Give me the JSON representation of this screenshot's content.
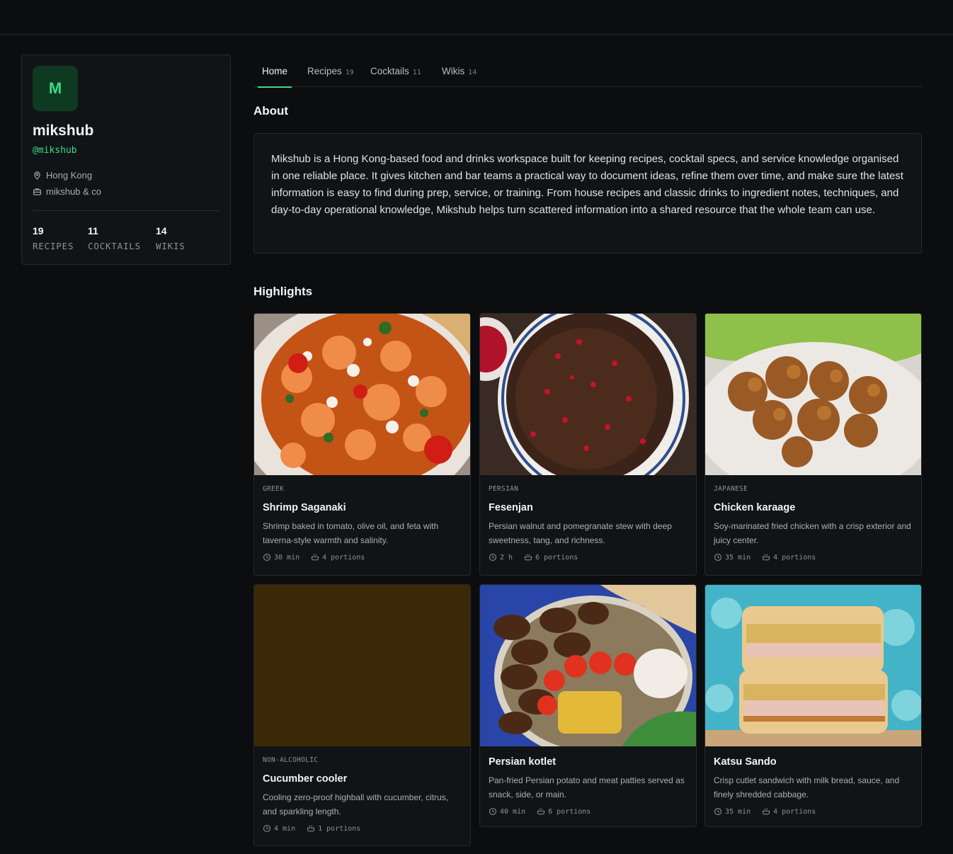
{
  "profile": {
    "avatar_letter": "M",
    "name": "mikshub",
    "handle": "@mikshub",
    "location": "Hong Kong",
    "company": "mikshub & co",
    "stats": [
      {
        "value": "19",
        "label": "RECIPES"
      },
      {
        "value": "11",
        "label": "COCKTAILS"
      },
      {
        "value": "14",
        "label": "WIKIS"
      }
    ]
  },
  "tabs": [
    {
      "label": "Home",
      "count": ""
    },
    {
      "label": "Recipes",
      "count": "19"
    },
    {
      "label": "Cocktails",
      "count": "11"
    },
    {
      "label": "Wikis",
      "count": "14"
    }
  ],
  "about": {
    "title": "About",
    "text": "Mikshub is a Hong Kong-based food and drinks workspace built for keeping recipes, cocktail specs, and service knowledge organised in one reliable place. It gives kitchen and bar teams a practical way to document ideas, refine them over time, and make sure the latest information is easy to find during prep, service, or training. From house recipes and classic drinks to ingredient notes, techniques, and day-to-day operational knowledge, Mikshub helps turn scattered information into a shared resource that the whole team can use."
  },
  "highlights": {
    "title": "Highlights",
    "cards": [
      {
        "cuisine": "GREEK",
        "title": "Shrimp Saganaki",
        "desc": "Shrimp baked in tomato, olive oil, and feta with taverna-style warmth and salinity.",
        "time": "30 min",
        "portions": "4 portions"
      },
      {
        "cuisine": "PERSIAN",
        "title": "Fesenjan",
        "desc": "Persian walnut and pomegranate stew with deep sweetness, tang, and richness.",
        "time": "2 h",
        "portions": "6 portions"
      },
      {
        "cuisine": "JAPANESE",
        "title": "Chicken karaage",
        "desc": "Soy-marinated fried chicken with a crisp exterior and juicy center.",
        "time": "35 min",
        "portions": "4 portions"
      },
      {
        "cuisine": "NON-ALCOHOLIC",
        "title": "Cucumber cooler",
        "desc": "Cooling zero-proof highball with cucumber, citrus, and sparkling length.",
        "time": "4 min",
        "portions": "1 portions"
      },
      {
        "cuisine": "",
        "title": "Persian kotlet",
        "desc": "Pan-fried Persian potato and meat patties served as snack, side, or main.",
        "time": "40 min",
        "portions": "6 portions"
      },
      {
        "cuisine": "",
        "title": "Katsu Sando",
        "desc": "Crisp cutlet sandwich with milk bread, sauce, and finely shredded cabbage.",
        "time": "35 min",
        "portions": "4 portions"
      }
    ]
  },
  "colors": {
    "accent": "#3ddc84",
    "background": "#0b0d0f",
    "card": "#111417"
  }
}
